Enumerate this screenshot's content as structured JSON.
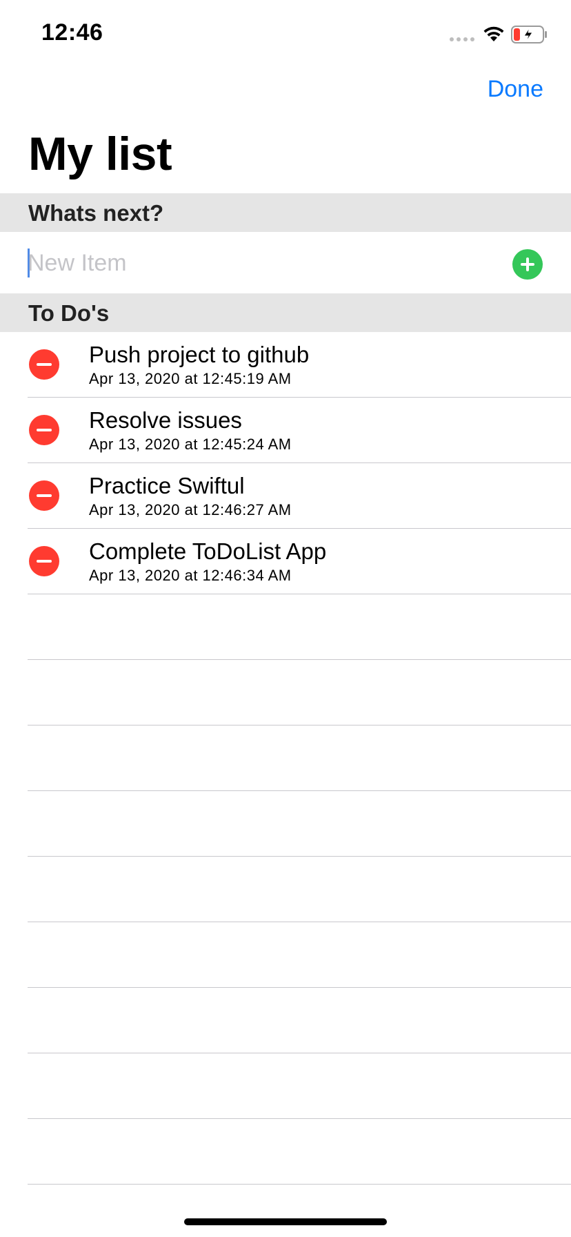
{
  "status_bar": {
    "time": "12:46",
    "battery_color": "#ff3b30"
  },
  "nav": {
    "done_label": "Done",
    "title": "My list"
  },
  "sections": {
    "next_header": "Whats next?",
    "todo_header": "To Do's"
  },
  "new_item": {
    "placeholder": "New Item",
    "value": "",
    "add_icon": "plus-circle-icon",
    "add_color": "#34c759"
  },
  "todos": [
    {
      "title": "Push project to github",
      "date": "Apr 13, 2020 at 12:45:19 AM"
    },
    {
      "title": "Resolve issues",
      "date": "Apr 13, 2020 at 12:45:24 AM"
    },
    {
      "title": "Practice Swiftul",
      "date": "Apr 13, 2020 at 12:46:27 AM"
    },
    {
      "title": "Complete ToDoList App",
      "date": "Apr 13, 2020 at 12:46:34 AM"
    }
  ],
  "delete_icon": "minus-circle-icon",
  "delete_color": "#ff3b30",
  "accent_color": "#0a7aff"
}
